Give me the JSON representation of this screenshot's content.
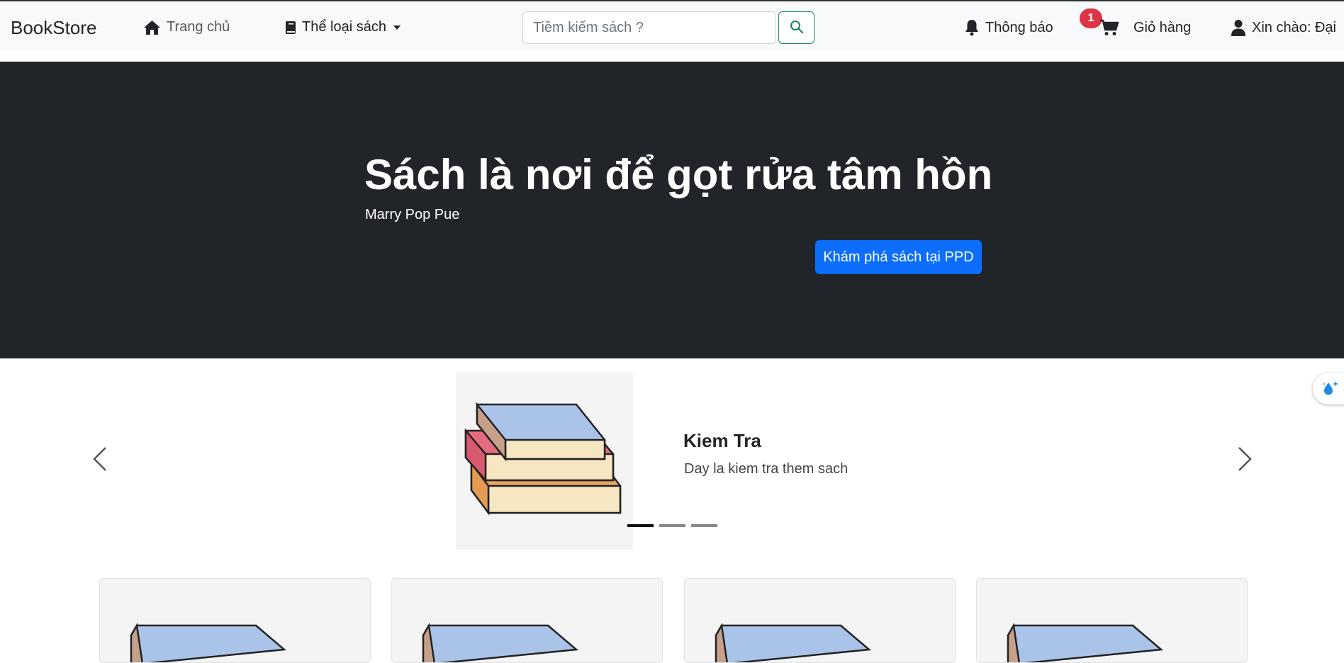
{
  "navbar": {
    "brand": "BookStore",
    "home_label": "Trang chủ",
    "categories_label": "Thể loại sách",
    "search_placeholder": "Tiềm kiếm sách ?",
    "notifications_label": "Thông báo",
    "cart_badge": "1",
    "cart_label": "Giỏ hàng",
    "greeting": "Xin chào: Đại"
  },
  "hero": {
    "title": "Sách là nơi để gọt rửa tâm hồn",
    "subtitle": "Marry Pop Pue",
    "button_label": "Khám phá sách tại PPD"
  },
  "carousel": {
    "title": "Kiem Tra",
    "text": "Day la kiem tra them sach",
    "slide_count": 3,
    "active_index": 0
  },
  "colors": {
    "navbar_bg": "#f8f9fa",
    "hero_bg": "#212529",
    "primary": "#0d6efd",
    "badge": "#dc3545",
    "search_border": "#198754"
  }
}
